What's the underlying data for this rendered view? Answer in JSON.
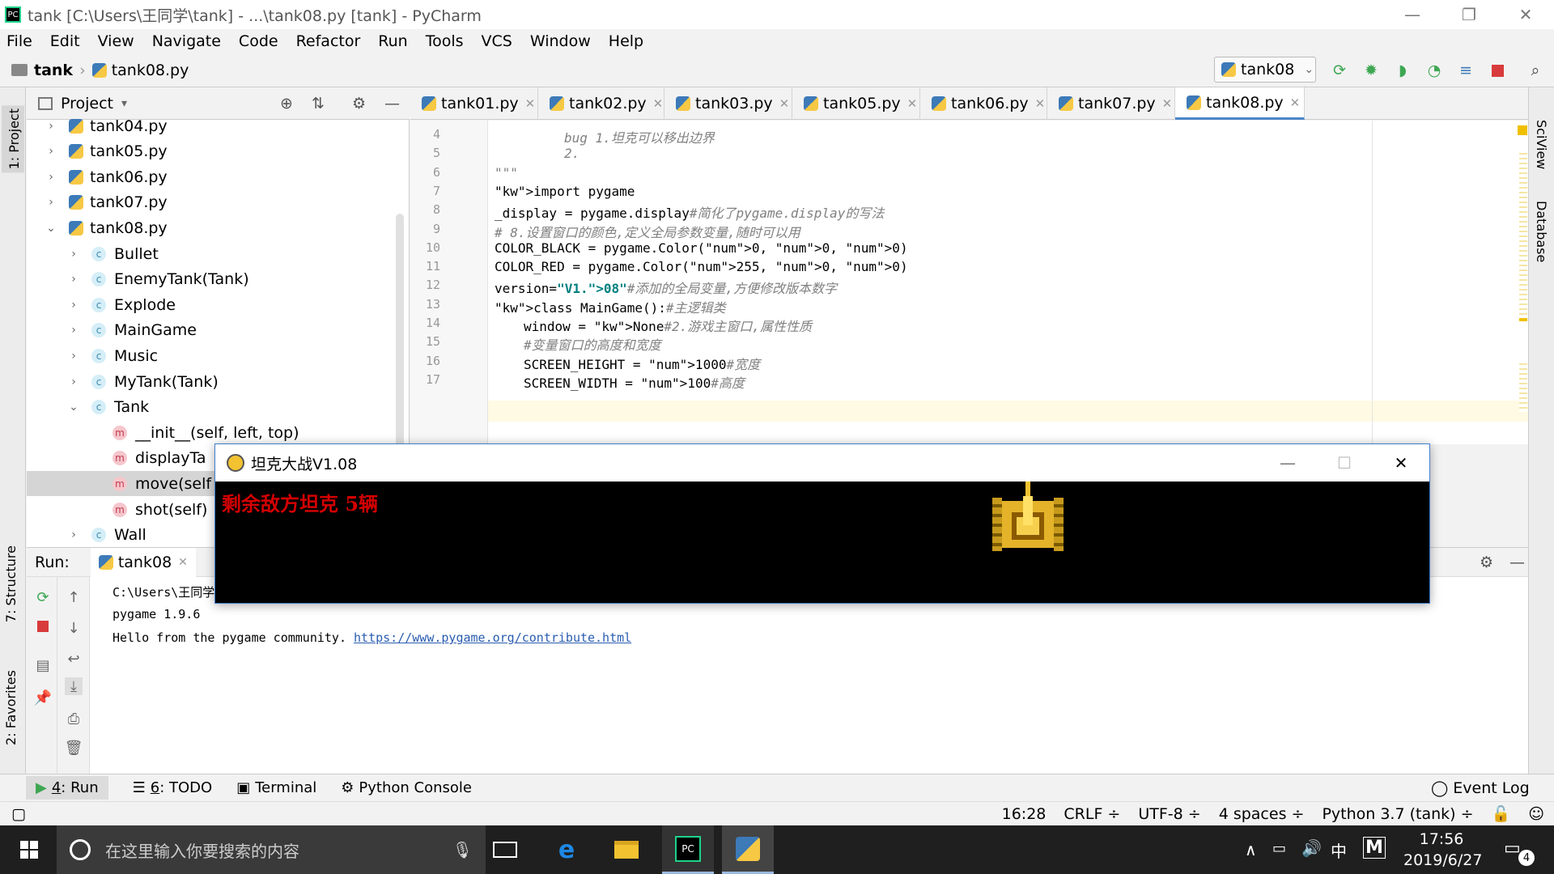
{
  "title_bar": {
    "text": "tank [C:\\Users\\王同学\\tank] - ...\\tank08.py [tank] - PyCharm",
    "app_icon": "PC"
  },
  "window_controls": {
    "minimize": "—",
    "restore": "❐",
    "close": "✕"
  },
  "menu": [
    "File",
    "Edit",
    "View",
    "Navigate",
    "Code",
    "Refactor",
    "Run",
    "Tools",
    "VCS",
    "Window",
    "Help"
  ],
  "breadcrumb": {
    "project": "tank",
    "file": "tank08.py"
  },
  "run_config": {
    "name": "tank08"
  },
  "project_panel": {
    "title": "Project",
    "tree": [
      {
        "label": "tank04.py",
        "type": "file",
        "depth": 0,
        "arrow": "›"
      },
      {
        "label": "tank05.py",
        "type": "file",
        "depth": 0,
        "arrow": "›"
      },
      {
        "label": "tank06.py",
        "type": "file",
        "depth": 0,
        "arrow": "›"
      },
      {
        "label": "tank07.py",
        "type": "file",
        "depth": 0,
        "arrow": "›"
      },
      {
        "label": "tank08.py",
        "type": "file",
        "depth": 0,
        "arrow": "⌄"
      },
      {
        "label": "Bullet",
        "type": "class",
        "depth": 1,
        "arrow": "›"
      },
      {
        "label": "EnemyTank(Tank)",
        "type": "class",
        "depth": 1,
        "arrow": "›"
      },
      {
        "label": "Explode",
        "type": "class",
        "depth": 1,
        "arrow": "›"
      },
      {
        "label": "MainGame",
        "type": "class",
        "depth": 1,
        "arrow": "›"
      },
      {
        "label": "Music",
        "type": "class",
        "depth": 1,
        "arrow": "›"
      },
      {
        "label": "MyTank(Tank)",
        "type": "class",
        "depth": 1,
        "arrow": "›"
      },
      {
        "label": "Tank",
        "type": "class",
        "depth": 1,
        "arrow": "⌄"
      },
      {
        "label": "__init__(self, left, top)",
        "type": "method",
        "depth": 2,
        "arrow": ""
      },
      {
        "label": "displayTa",
        "type": "method",
        "depth": 2,
        "arrow": ""
      },
      {
        "label": "move(self",
        "type": "method",
        "depth": 2,
        "arrow": ""
      },
      {
        "label": "shot(self)",
        "type": "method",
        "depth": 2,
        "arrow": ""
      },
      {
        "label": "Wall",
        "type": "class",
        "depth": 1,
        "arrow": "›"
      }
    ]
  },
  "editor_tabs": [
    "tank01.py",
    "tank02.py",
    "tank03.py",
    "tank05.py",
    "tank06.py",
    "tank07.py",
    "tank08.py"
  ],
  "active_tab": "tank08.py",
  "code_lines": [
    {
      "n": "4",
      "text": "bug 1.坦克可以移出边界"
    },
    {
      "n": "5",
      "text": "2."
    },
    {
      "n": "6",
      "text": "\"\"\""
    },
    {
      "n": "7",
      "text": "import pygame"
    },
    {
      "n": "8",
      "text": "_display = pygame.display#简化了pygame.display的写法"
    },
    {
      "n": "9",
      "text": "# 8.设置窗口的颜色,定义全局参数变量,随时可以用"
    },
    {
      "n": "10",
      "text": "COLOR_BLACK = pygame.Color(0, 0, 0)"
    },
    {
      "n": "11",
      "text": "COLOR_RED = pygame.Color(255, 0, 0)"
    },
    {
      "n": "12",
      "text": "version=\"V1.08\"#添加的全局变量,方便修改版本数字"
    },
    {
      "n": "13",
      "text": "class MainGame():#主逻辑类"
    },
    {
      "n": "14",
      "text": "window = None#2.游戏主窗口,属性性质"
    },
    {
      "n": "15",
      "text": "#变量窗口的高度和宽度"
    },
    {
      "n": "16",
      "text": "SCREEN_HEIGHT = 1000#宽度"
    },
    {
      "n": "17",
      "text": "SCREEN_WIDTH = 100#高度"
    }
  ],
  "run_panel": {
    "label": "Run:",
    "tab": "tank08",
    "output": [
      "C:\\Users\\王同学",
      "pygame 1.9.6",
      "Hello from the pygame community. "
    ],
    "link": "https://www.pygame.org/contribute.html"
  },
  "game_window": {
    "title": "坦克大战V1.08",
    "hud_text": "剩余敌方坦克 5辆",
    "hud_color": "#d40000"
  },
  "left_tool_tabs": {
    "project": "1: Project",
    "structure": "7: Structure",
    "favorites": "2: Favorites"
  },
  "right_tool_tabs": {
    "sciview": "SciView",
    "database": "Database"
  },
  "bottom_tabs": [
    {
      "num": "4",
      "label": ": Run"
    },
    {
      "num": "6",
      "label": ": TODO"
    },
    {
      "num": "",
      "label": "Terminal"
    },
    {
      "num": "",
      "label": "Python Console"
    }
  ],
  "event_log": "Event Log",
  "status_bar": [
    "16:28",
    "CRLF ÷",
    "UTF-8 ÷",
    "4 spaces ÷",
    "Python 3.7 (tank) ÷"
  ],
  "taskbar": {
    "search_placeholder": "在这里输入你要搜索的内容",
    "time": "17:56",
    "date": "2019/6/27",
    "ime": "中",
    "notification_count": "4"
  },
  "colors": {
    "accent": "#4b86c7",
    "run_green": "#3da752",
    "stop_red": "#d83b3b"
  }
}
